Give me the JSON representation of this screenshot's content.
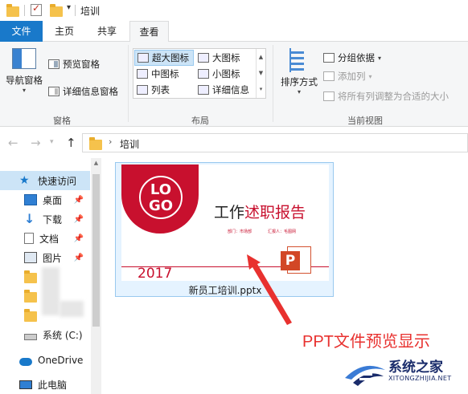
{
  "window": {
    "title": "培训"
  },
  "ribbon_tabs": {
    "file": "文件",
    "home": "主页",
    "share": "共享",
    "view": "查看"
  },
  "ribbon": {
    "panes": {
      "nav_pane": "导航窗格",
      "preview_pane": "预览窗格",
      "details_pane": "详细信息窗格",
      "group_label": "窗格"
    },
    "layout": {
      "extra_large_icons": "超大图标",
      "large_icons": "大图标",
      "medium_icons": "中图标",
      "small_icons": "小图标",
      "list": "列表",
      "details": "详细信息",
      "group_label": "布局",
      "selected": "超大图标"
    },
    "current_view": {
      "sort_by": "排序方式",
      "group_by": "分组依据",
      "add_columns": "添加列",
      "size_all_columns": "将所有列调整为合适的大小",
      "group_label": "当前视图"
    }
  },
  "address_bar": {
    "path": "培训"
  },
  "nav_pane": {
    "quick_access": "快速访问",
    "items": [
      {
        "label": "桌面",
        "icon": "desktop-icon",
        "pinned": true
      },
      {
        "label": "下载",
        "icon": "download-arrow-icon",
        "pinned": true
      },
      {
        "label": "文档",
        "icon": "document-icon",
        "pinned": true
      },
      {
        "label": "图片",
        "icon": "picture-icon",
        "pinned": true
      }
    ],
    "drive": "系统 (C:)",
    "onedrive": "OneDrive",
    "this_pc": "此电脑"
  },
  "file": {
    "name": "新员工培训.pptx",
    "preview": {
      "logo_line1": "LO",
      "logo_line2": "GO",
      "title_black": "工作",
      "title_red": "述职报告",
      "meta_dept": "部门：市场部",
      "meta_reporter": "汇报人：毛图网",
      "year": "2017",
      "badge": "P"
    }
  },
  "annotation": {
    "text": "PPT文件预览显示"
  },
  "watermark": {
    "cn": "系统之家",
    "en": "XITONGZHIJIA.NET"
  },
  "colors": {
    "accent_blue": "#1979ca",
    "ppt_red": "#c8102e",
    "annotation_red": "#e8312f",
    "selection": "#cce4f7"
  }
}
